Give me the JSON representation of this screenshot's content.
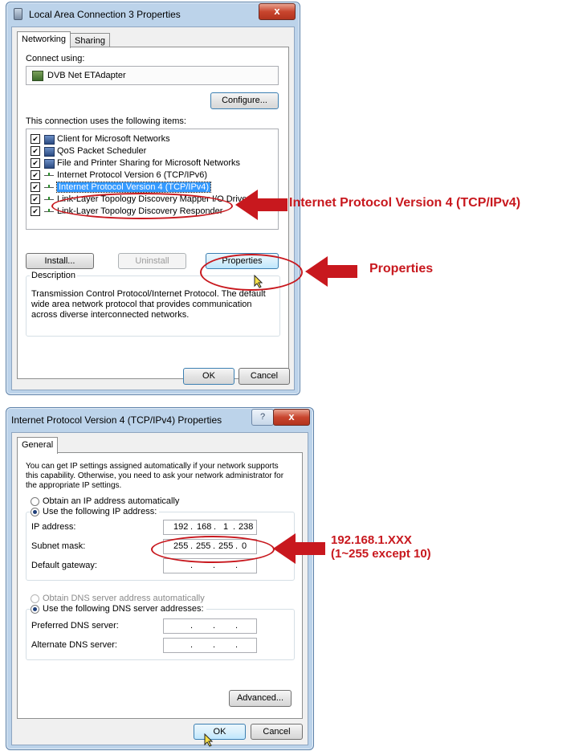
{
  "dialog1": {
    "title": "Local Area Connection 3 Properties",
    "close_glyph": "x",
    "tabs": [
      "Networking",
      "Sharing"
    ],
    "connect_using_label": "Connect using:",
    "adapter_name": "DVB Net ETAdapter",
    "configure_label": "Configure...",
    "items_label": "This connection uses the following items:",
    "items": [
      {
        "label": "Client for Microsoft Networks",
        "checked": true,
        "icon": "network-client-icon"
      },
      {
        "label": "QoS Packet Scheduler",
        "checked": true,
        "icon": "scheduler-icon"
      },
      {
        "label": "File and Printer Sharing for Microsoft Networks",
        "checked": true,
        "icon": "printer-sharing-icon"
      },
      {
        "label": "Internet Protocol Version 6 (TCP/IPv6)",
        "checked": true,
        "icon": "protocol-icon"
      },
      {
        "label": "Internet Protocol Version 4 (TCP/IPv4)",
        "checked": true,
        "icon": "protocol-icon",
        "selected": true
      },
      {
        "label": "Link-Layer Topology Discovery Mapper I/O Driver",
        "checked": true,
        "icon": "protocol-icon"
      },
      {
        "label": "Link-Layer Topology Discovery Responder",
        "checked": true,
        "icon": "protocol-icon"
      }
    ],
    "install_label": "Install...",
    "uninstall_label": "Uninstall",
    "properties_label": "Properties",
    "description_label": "Description",
    "description_text": "Transmission Control Protocol/Internet Protocol. The default wide area network protocol that provides communication across diverse interconnected networks.",
    "ok_label": "OK",
    "cancel_label": "Cancel"
  },
  "dialog2": {
    "title": "Internet Protocol Version 4 (TCP/IPv4) Properties",
    "help_glyph": "?",
    "close_glyph": "x",
    "tab": "General",
    "intro": "You can get IP settings assigned automatically if your network supports this capability. Otherwise, you need to ask your network administrator for the appropriate IP settings.",
    "obtain_ip_auto": "Obtain an IP address automatically",
    "use_following_ip": "Use the following IP address:",
    "ip_address_label": "IP address:",
    "ip_address": [
      "192",
      "168",
      "1",
      "238"
    ],
    "subnet_label": "Subnet mask:",
    "subnet": [
      "255",
      "255",
      "255",
      "0"
    ],
    "gateway_label": "Default gateway:",
    "obtain_dns_auto": "Obtain DNS server address automatically",
    "use_following_dns": "Use the following DNS server addresses:",
    "preferred_dns_label": "Preferred DNS server:",
    "alternate_dns_label": "Alternate DNS server:",
    "dot": ".",
    "advanced_label": "Advanced...",
    "ok_label": "OK",
    "cancel_label": "Cancel"
  },
  "callouts": {
    "ipv4": "Internet Protocol Version 4 (TCP/IPv4)",
    "properties": "Properties",
    "ip_line1": "192.168.1.XXX",
    "ip_line2": "(1~255 except 10)"
  },
  "colors": {
    "callout_red": "#c8181e",
    "selection_blue": "#3399ff",
    "window_frame": "#bcd3ea"
  }
}
